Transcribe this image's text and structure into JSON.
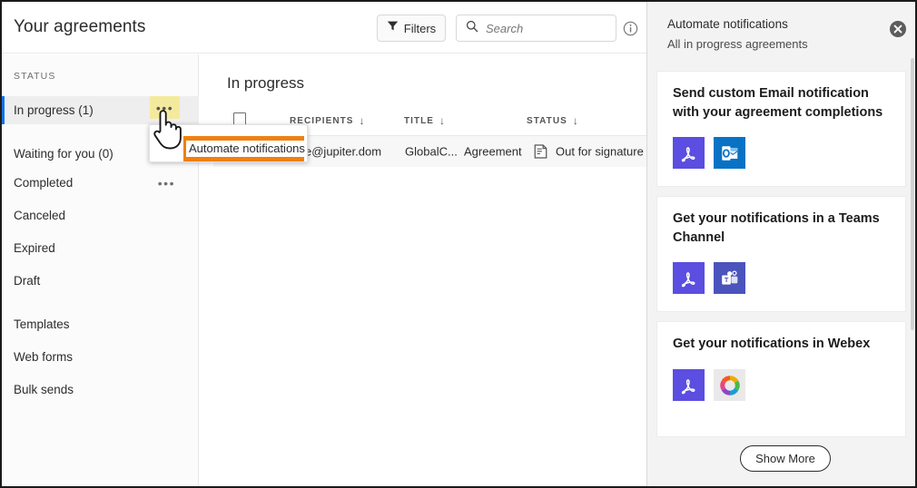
{
  "header": {
    "title": "Your agreements",
    "filters_label": "Filters",
    "filter_icon": "funnel-icon",
    "search_placeholder": "Search",
    "search_value": "",
    "search_icon": "search-icon",
    "info_icon": "info-circle-icon"
  },
  "sidebar": {
    "section_label": "STATUS",
    "dots_glyph": "•••",
    "items": [
      {
        "label": "In progress (1)",
        "selected": true,
        "has_menu": true
      },
      {
        "label": "Waiting for you (0)",
        "selected": false,
        "has_menu": false
      },
      {
        "label": "Completed",
        "selected": false,
        "has_menu": true
      },
      {
        "label": "Canceled",
        "selected": false,
        "has_menu": false
      },
      {
        "label": "Expired",
        "selected": false,
        "has_menu": false
      },
      {
        "label": "Draft",
        "selected": false,
        "has_menu": false
      }
    ],
    "links": [
      {
        "label": "Templates"
      },
      {
        "label": "Web forms"
      },
      {
        "label": "Bulk sends"
      }
    ]
  },
  "context_menu": {
    "item_label": "Automate notifications",
    "highlight_color": "#ef8010",
    "trigger_highlight_color": "#f4ea9e"
  },
  "content": {
    "heading": "In progress",
    "columns": [
      {
        "label": "RECIPIENTS",
        "sort_glyph": "↓"
      },
      {
        "label": "TITLE",
        "sort_glyph": "↓"
      },
      {
        "label": "STATUS",
        "sort_glyph": "↓"
      }
    ],
    "rows": [
      {
        "recipients": "e@jupiter.dom",
        "recipients_secondary": "GlobalC...",
        "title": "Agreement",
        "status_icon": "document-lines-icon",
        "status": "Out for signature"
      }
    ]
  },
  "right_panel": {
    "title": "Automate notifications",
    "subtitle": "All in progress agreements",
    "close_icon": "close-circle-icon",
    "cards": [
      {
        "title": "Send custom Email notification with your agreement completions",
        "icons": [
          {
            "name": "adobe-acrobat-icon",
            "color": "#5b4ee0"
          },
          {
            "name": "microsoft-outlook-icon",
            "color": "#0a72c4"
          }
        ]
      },
      {
        "title": "Get your notifications in a Teams Channel",
        "icons": [
          {
            "name": "adobe-acrobat-icon",
            "color": "#5b4ee0"
          },
          {
            "name": "microsoft-teams-icon",
            "color": "#4b53bc"
          }
        ]
      },
      {
        "title": "Get your notifications in Webex",
        "icons": [
          {
            "name": "adobe-acrobat-icon",
            "color": "#5b4ee0"
          },
          {
            "name": "webex-icon",
            "color": "#e9e9e9"
          }
        ]
      }
    ],
    "show_more_label": "Show More"
  }
}
